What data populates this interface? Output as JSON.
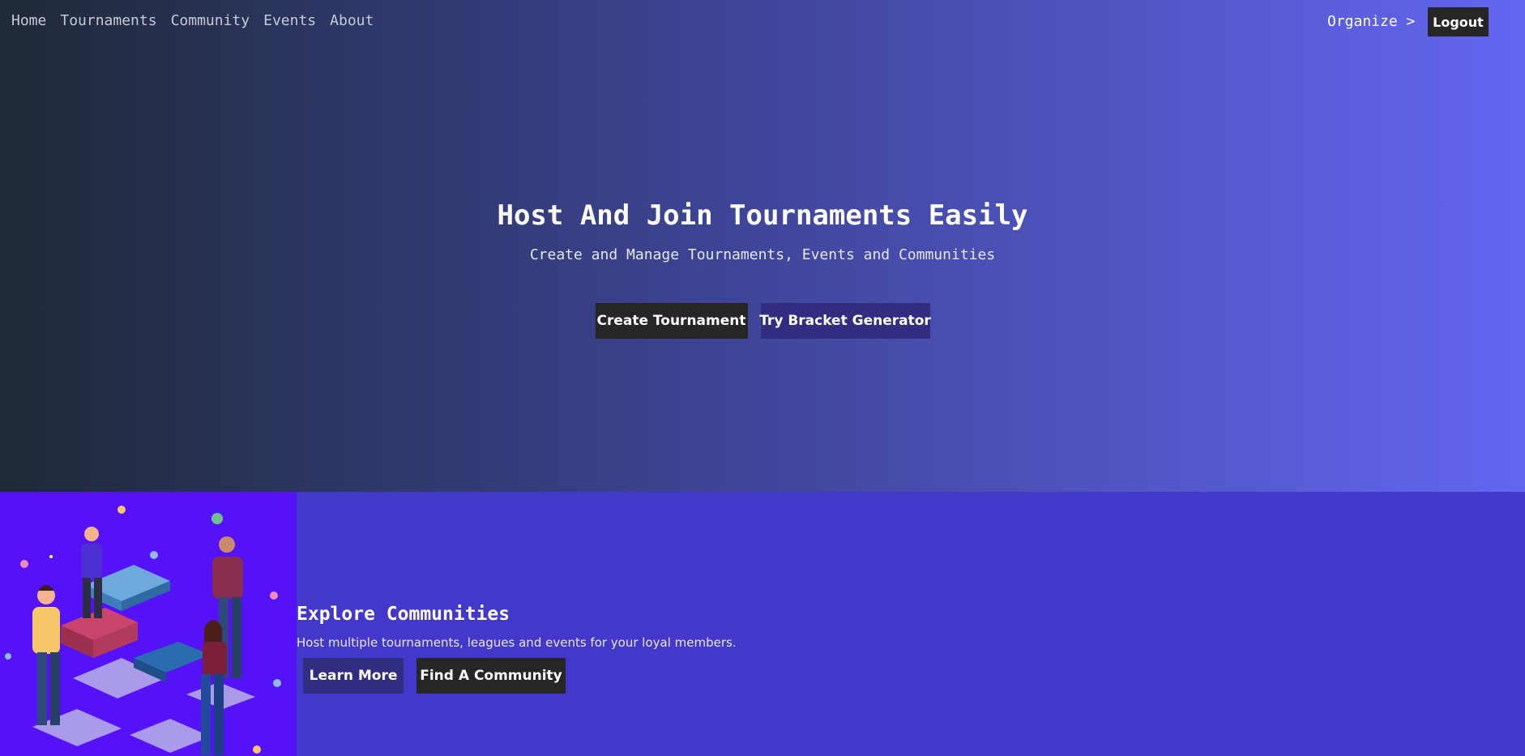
{
  "nav": {
    "links": [
      "Home",
      "Tournaments",
      "Community",
      "Events",
      "About"
    ],
    "organize_label": "Organize >",
    "logout_label": "Logout"
  },
  "hero": {
    "title": "Host And Join Tournaments Easily",
    "subtitle": "Create and Manage Tournaments, Events and Communities",
    "primary_button": "Create Tournament",
    "secondary_button": "Try Bracket Generator"
  },
  "communities": {
    "title": "Explore Communities",
    "description": "Host multiple tournaments, leagues and events for your loyal members.",
    "learn_more_button": "Learn More",
    "find_button": "Find A Community",
    "illustration_icon": "people-assembling-puzzle-illustration"
  },
  "colors": {
    "hero_gradient_start": "#1f2937",
    "hero_gradient_end": "#6366f1",
    "section_background": "#4338ca",
    "illustration_background": "#5512f6",
    "button_dark": "#262626",
    "button_indigo": "#312e81"
  }
}
